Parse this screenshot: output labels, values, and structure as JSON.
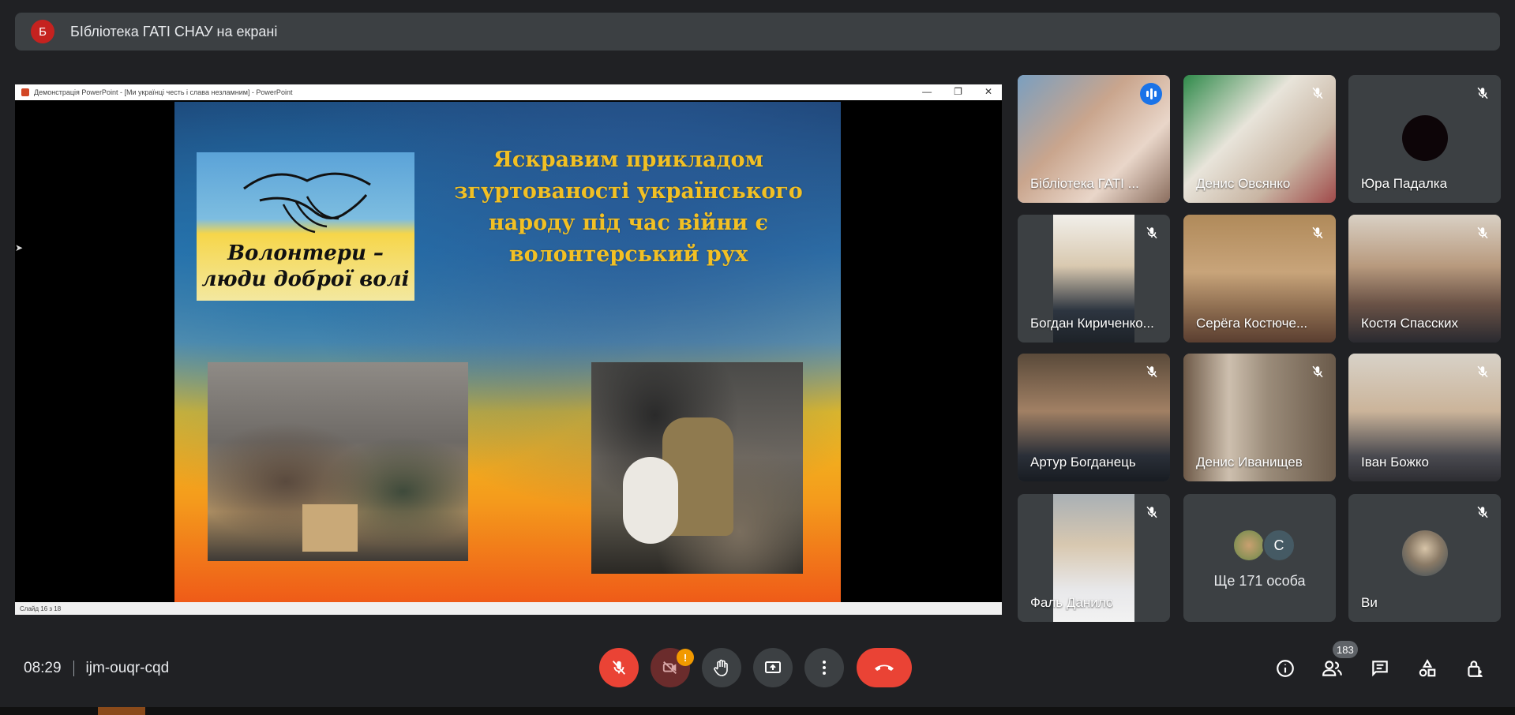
{
  "banner": {
    "avatar_letter": "Б",
    "title": "БІбліотека ГАТІ СНАУ на екрані"
  },
  "presentation": {
    "window_title": "Демонстрація PowerPoint - [Ми українці честь і слава незламним] - PowerPoint",
    "window_buttons": [
      "—",
      "❐",
      "✕"
    ],
    "slide_status": "Слайд 16 з 18",
    "card_text_line1": "Волонтери –",
    "card_text_line2": "люди доброї волі",
    "headline": "Яскравим прикладом згуртованості українського народу під час війни є волонтерський рух"
  },
  "participants": [
    {
      "name": "Бібліотека ГАТІ ...",
      "state": "speaking"
    },
    {
      "name": "Денис Овсянко",
      "state": "muted"
    },
    {
      "name": "Юра Падалка",
      "state": "muted"
    },
    {
      "name": "Богдан Кириченко...",
      "state": "muted"
    },
    {
      "name": "Серёга Костюче...",
      "state": "muted"
    },
    {
      "name": "Костя Спасских",
      "state": "muted"
    },
    {
      "name": "Артур Богданець",
      "state": "muted"
    },
    {
      "name": "Денис Иванищев",
      "state": "muted"
    },
    {
      "name": "Іван Божко",
      "state": "muted"
    },
    {
      "name": "Фаль Данило",
      "state": "muted"
    },
    {
      "name": "Ще 171 особа",
      "state": "others",
      "avatar_letter": "С"
    },
    {
      "name": "Ви",
      "state": "muted"
    }
  ],
  "footer": {
    "time": "08:29",
    "meeting_code": "ijm-ouqr-cqd",
    "camera_warning": "!",
    "participants_count": "183"
  },
  "colors": {
    "accent": "#8ab4f8",
    "danger": "#ea4335",
    "warning": "#f29900",
    "surface": "#3c4043"
  }
}
